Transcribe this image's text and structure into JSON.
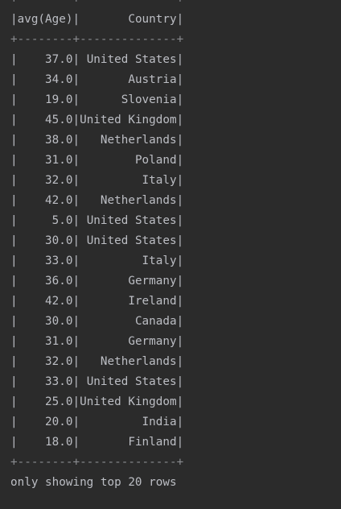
{
  "console": {
    "separator": "+--------+--------------+",
    "header": {
      "age": "avg(Age)",
      "country": "Country"
    },
    "rows": [
      {
        "age": "37.0",
        "country": "United States"
      },
      {
        "age": "34.0",
        "country": "Austria"
      },
      {
        "age": "19.0",
        "country": "Slovenia"
      },
      {
        "age": "45.0",
        "country": "United Kingdom"
      },
      {
        "age": "38.0",
        "country": "Netherlands"
      },
      {
        "age": "31.0",
        "country": "Poland"
      },
      {
        "age": "32.0",
        "country": "Italy"
      },
      {
        "age": "42.0",
        "country": "Netherlands"
      },
      {
        "age": "5.0",
        "country": "United States"
      },
      {
        "age": "30.0",
        "country": "United States"
      },
      {
        "age": "33.0",
        "country": "Italy"
      },
      {
        "age": "36.0",
        "country": "Germany"
      },
      {
        "age": "42.0",
        "country": "Ireland"
      },
      {
        "age": "30.0",
        "country": "Canada"
      },
      {
        "age": "31.0",
        "country": "Germany"
      },
      {
        "age": "32.0",
        "country": "Netherlands"
      },
      {
        "age": "33.0",
        "country": "United States"
      },
      {
        "age": "25.0",
        "country": "United Kingdom"
      },
      {
        "age": "20.0",
        "country": "India"
      },
      {
        "age": "18.0",
        "country": "Finland"
      }
    ],
    "footer": "only showing top 20 rows"
  }
}
